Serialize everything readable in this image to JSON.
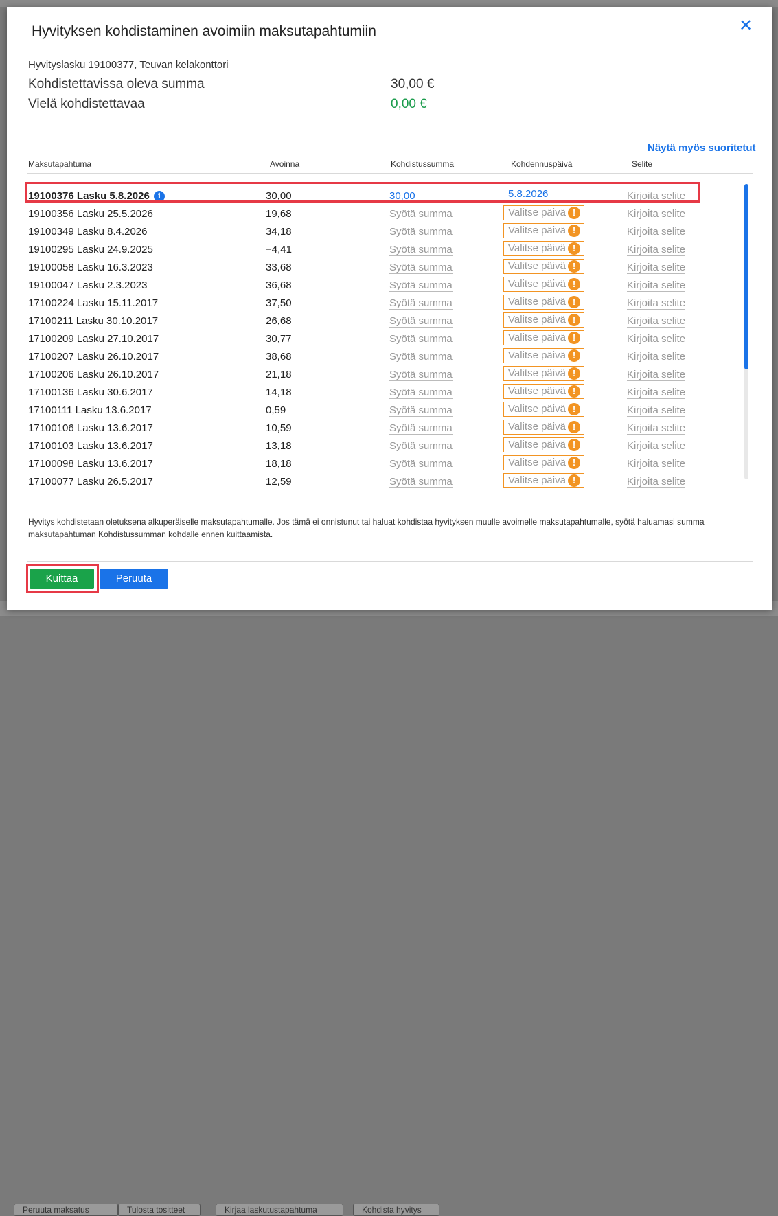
{
  "background": {
    "buttons": [
      "Peruuta maksatus",
      "Tulosta tositteet",
      "Kirjaa laskutustapahtuma",
      "Kohdista hyvitys"
    ]
  },
  "dialog": {
    "title": "Hyvityksen kohdistaminen avoimiin maksutapahtumiin",
    "close_icon": "close-icon",
    "invoice_line": "Hyvityslasku 19100377, Teuvan kelakonttori",
    "allocatable_label": "Kohdistettavissa oleva summa",
    "allocatable_value": "30,00 €",
    "remaining_label": "Vielä kohdistettavaa",
    "remaining_value": "0,00 €",
    "remaining_color": "#1a9b4b",
    "show_paid_link": "Näytä myös suoritetut",
    "columns": {
      "transaction": "Maksutapahtuma",
      "open": "Avoinna",
      "amount": "Kohdistussumma",
      "date": "Kohdennuspäivä",
      "note": "Selite"
    },
    "placeholders": {
      "amount": "Syötä summa",
      "date": "Valitse päivä",
      "note": "Kirjoita selite"
    },
    "rows": [
      {
        "name": "19100376 Lasku 5.8.2026",
        "open": "30,00",
        "amount": "30,00",
        "date": "5.8.2026",
        "selected": true
      },
      {
        "name": "19100356 Lasku 25.5.2026",
        "open": "19,68"
      },
      {
        "name": "19100349 Lasku 8.4.2026",
        "open": "34,18"
      },
      {
        "name": "19100295 Lasku 24.9.2025",
        "open": "−4,41"
      },
      {
        "name": "19100058 Lasku 16.3.2023",
        "open": "33,68"
      },
      {
        "name": "19100047 Lasku 2.3.2023",
        "open": "36,68"
      },
      {
        "name": "17100224 Lasku 15.11.2017",
        "open": "37,50"
      },
      {
        "name": "17100211 Lasku 30.10.2017",
        "open": "26,68"
      },
      {
        "name": "17100209 Lasku 27.10.2017",
        "open": "30,77"
      },
      {
        "name": "17100207 Lasku 26.10.2017",
        "open": "38,68"
      },
      {
        "name": "17100206 Lasku 26.10.2017",
        "open": "21,18"
      },
      {
        "name": "17100136 Lasku 30.6.2017",
        "open": "14,18"
      },
      {
        "name": "17100111 Lasku 13.6.2017",
        "open": "0,59"
      },
      {
        "name": "17100106 Lasku 13.6.2017",
        "open": "10,59"
      },
      {
        "name": "17100103 Lasku 13.6.2017",
        "open": "13,18"
      },
      {
        "name": "17100098 Lasku 13.6.2017",
        "open": "18,18"
      },
      {
        "name": "17100077 Lasku 26.5.2017",
        "open": "12,59"
      }
    ],
    "footnote": "Hyvitys kohdistetaan oletuksena alkuperäiselle maksutapahtumalle. Jos tämä ei onnistunut tai haluat kohdistaa hyvityksen muulle avoimelle maksutapahtumalle, syötä haluamasi summa maksutapahtuman Kohdistussumman kohdalle ennen kuittaamista.",
    "confirm_button": "Kuittaa",
    "cancel_button": "Peruuta",
    "accent_color": "#1a73e8",
    "warning_color": "#f29423",
    "confirm_color": "#1aa34a",
    "highlight_color": "#e63946"
  }
}
